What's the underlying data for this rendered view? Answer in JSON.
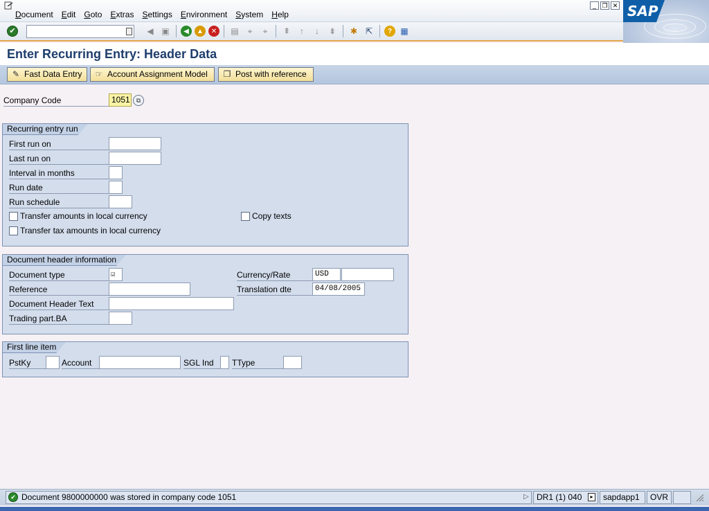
{
  "menu": {
    "items": [
      {
        "label": "Document"
      },
      {
        "label": "Edit"
      },
      {
        "label": "Goto"
      },
      {
        "label": "Extras"
      },
      {
        "label": "Settings"
      },
      {
        "label": "Environment"
      },
      {
        "label": "System"
      },
      {
        "label": "Help"
      }
    ]
  },
  "brand": {
    "logo_text": "SAP",
    "color": "#0f5fa8"
  },
  "toolbar": {
    "command_field_value": ""
  },
  "title": "Enter Recurring Entry: Header Data",
  "app_toolbar": {
    "fast_data_entry": "Fast Data Entry",
    "account_assignment_model": "Account Assignment Model",
    "post_with_reference": "Post with reference"
  },
  "company_code": {
    "label": "Company Code",
    "value": "1051"
  },
  "recurring": {
    "title": "Recurring entry run",
    "first_run_on": {
      "label": "First run on",
      "value": ""
    },
    "last_run_on": {
      "label": "Last run on",
      "value": ""
    },
    "interval_in_months": {
      "label": "Interval in months",
      "value": ""
    },
    "run_date": {
      "label": "Run date",
      "value": ""
    },
    "run_schedule": {
      "label": "Run schedule",
      "value": ""
    },
    "transfer_amounts": {
      "label": "Transfer amounts in local currency",
      "checked": false
    },
    "transfer_tax": {
      "label": "Transfer tax amounts in local currency",
      "checked": false
    },
    "copy_texts": {
      "label": "Copy texts",
      "checked": false
    }
  },
  "doc_header": {
    "title": "Document header information",
    "document_type": {
      "label": "Document type",
      "value": ""
    },
    "reference": {
      "label": "Reference",
      "value": ""
    },
    "header_text": {
      "label": "Document Header Text",
      "value": ""
    },
    "trading_part": {
      "label": "Trading part.BA",
      "value": ""
    },
    "currency_rate": {
      "label": "Currency/Rate",
      "currency": "USD",
      "rate": ""
    },
    "translation_date": {
      "label": "Translation dte",
      "value": "04/08/2005"
    }
  },
  "first_line": {
    "title": "First line item",
    "pstky": {
      "label": "PstKy",
      "value": ""
    },
    "account": {
      "label": "Account",
      "value": ""
    },
    "sgl_ind": {
      "label": "SGL Ind",
      "value": ""
    },
    "ttype": {
      "label": "TType",
      "value": ""
    }
  },
  "status": {
    "message": "Document 9800000000 was stored in company code 1051",
    "system": "DR1 (1) 040",
    "server": "sapdapp1",
    "mode": "OVR"
  }
}
